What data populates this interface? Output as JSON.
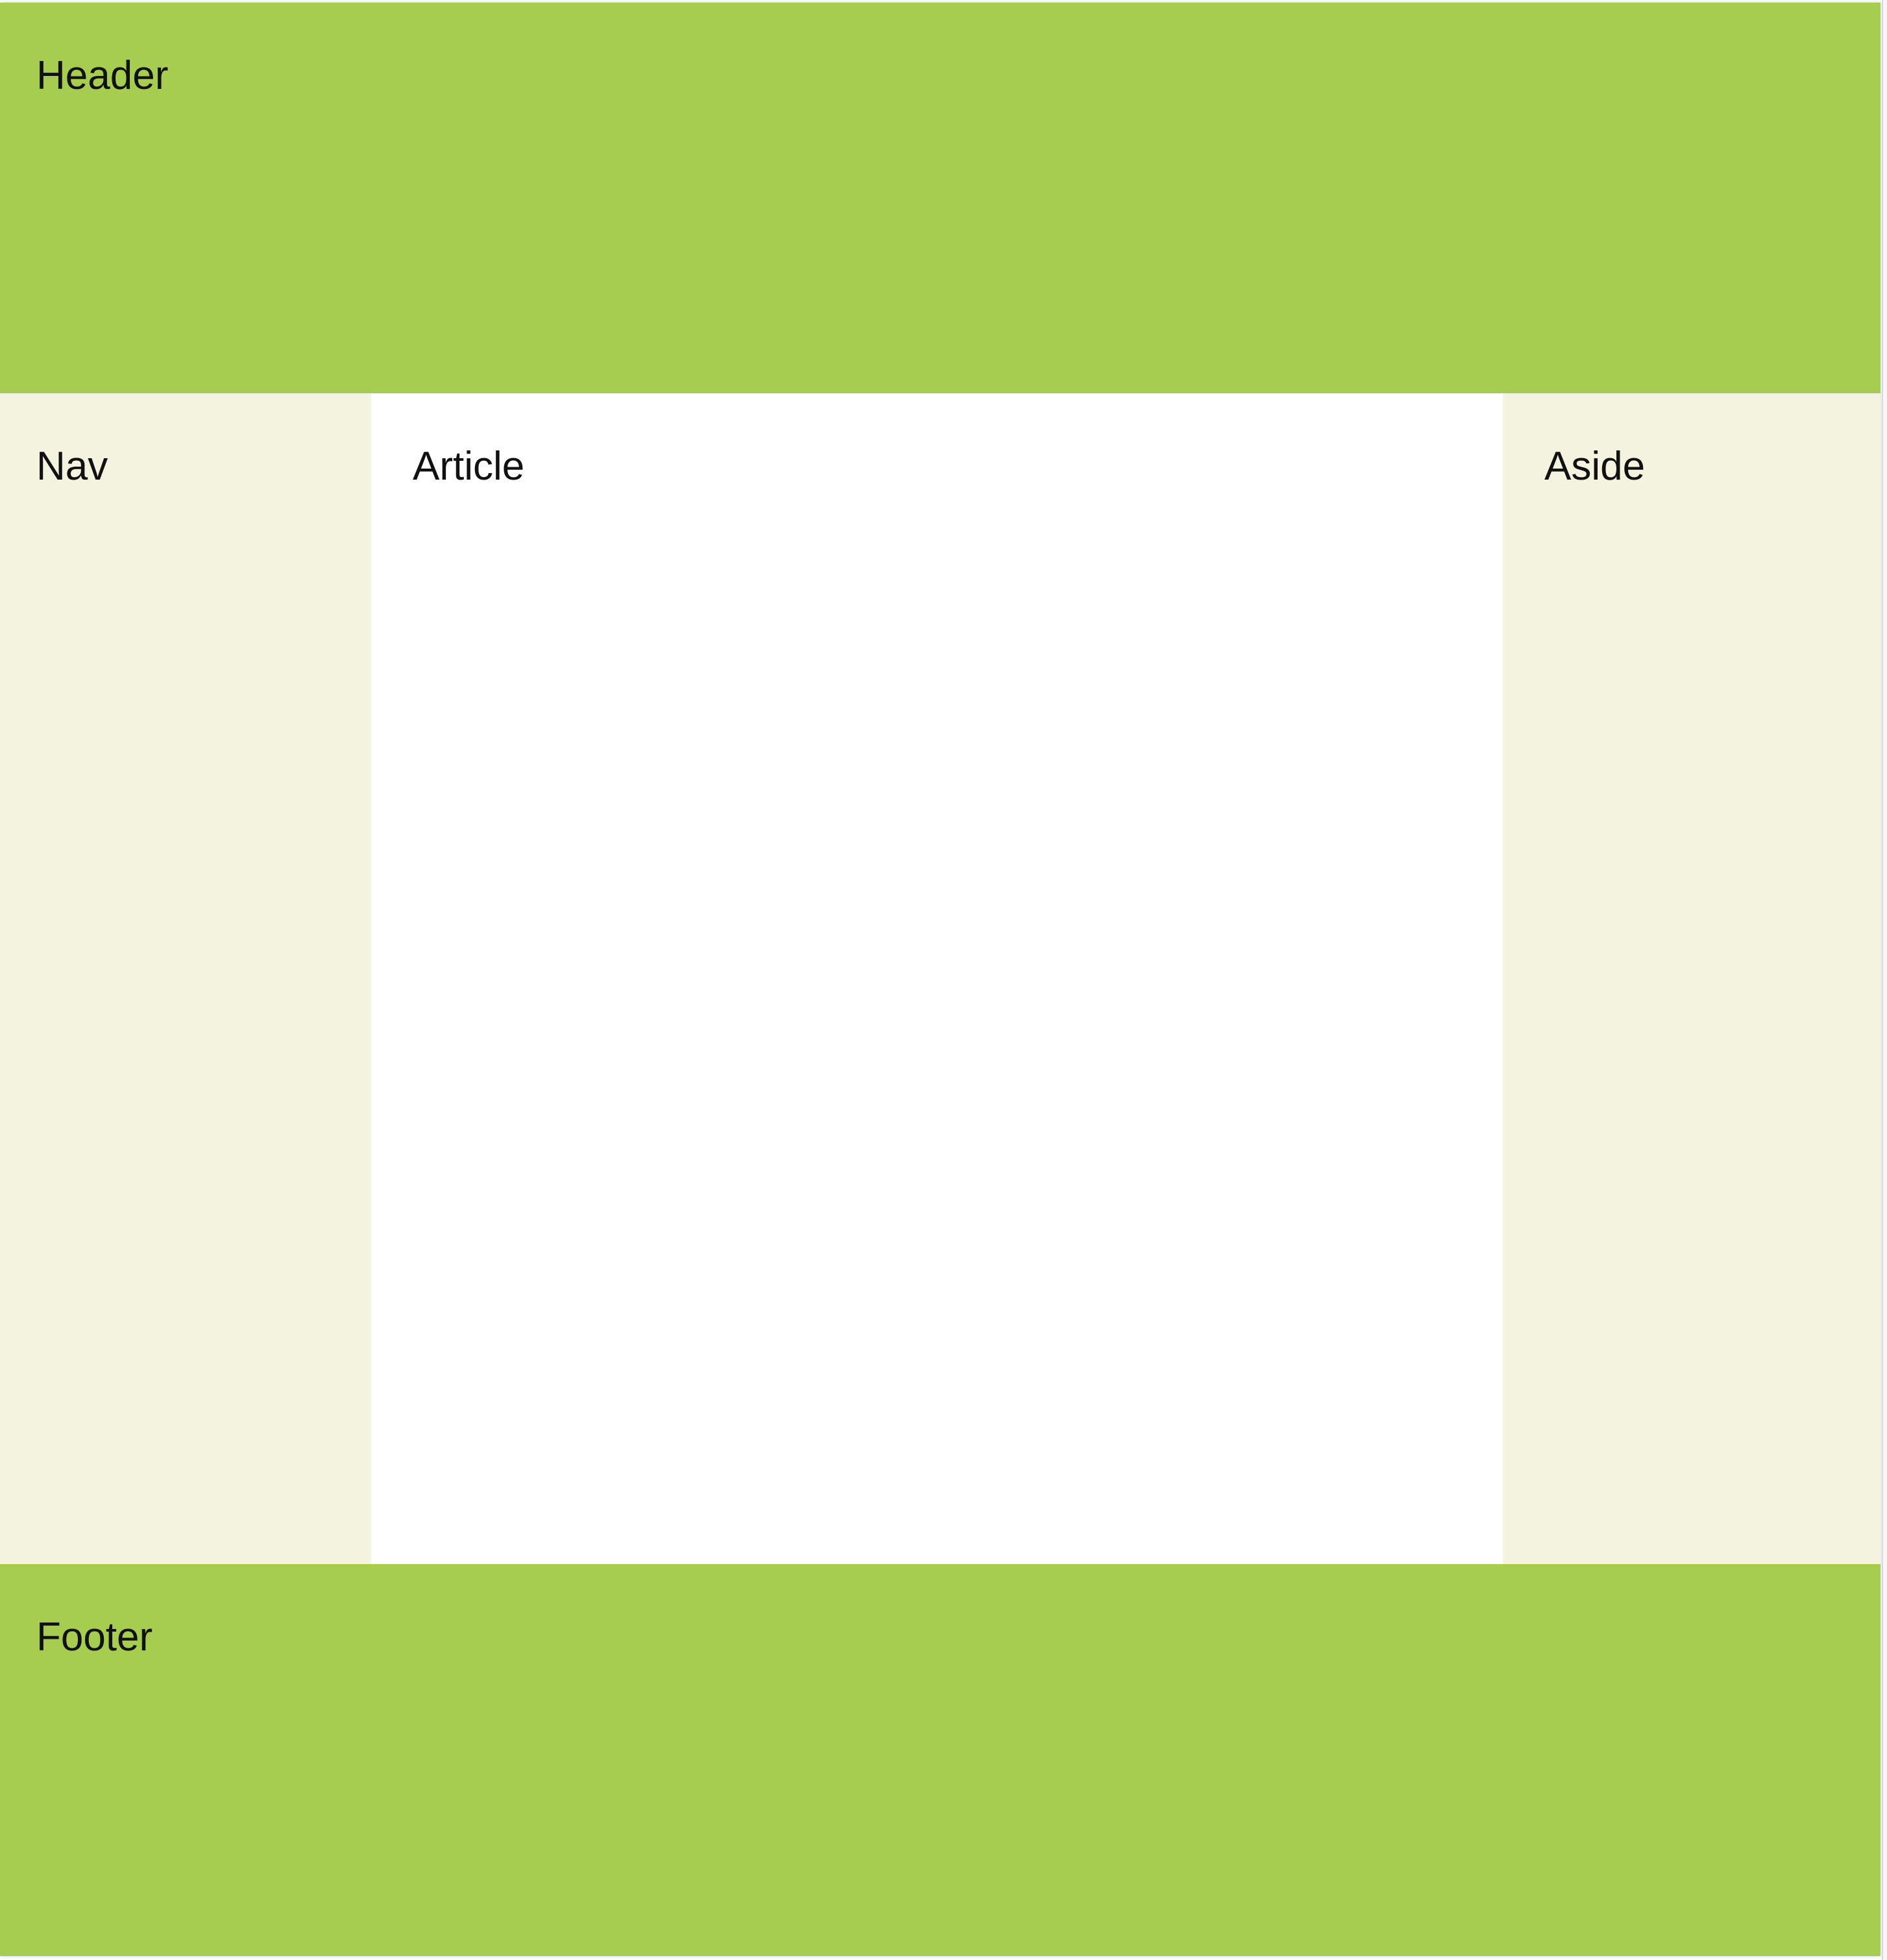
{
  "layout": {
    "header": {
      "label": "Header"
    },
    "nav": {
      "label": "Nav"
    },
    "article": {
      "label": "Article"
    },
    "aside": {
      "label": "Aside"
    },
    "footer": {
      "label": "Footer"
    }
  },
  "colors": {
    "header_footer_bg": "#a6cd50",
    "side_bg": "#f3f3e0",
    "article_bg": "#ffffff",
    "text": "#111111"
  }
}
